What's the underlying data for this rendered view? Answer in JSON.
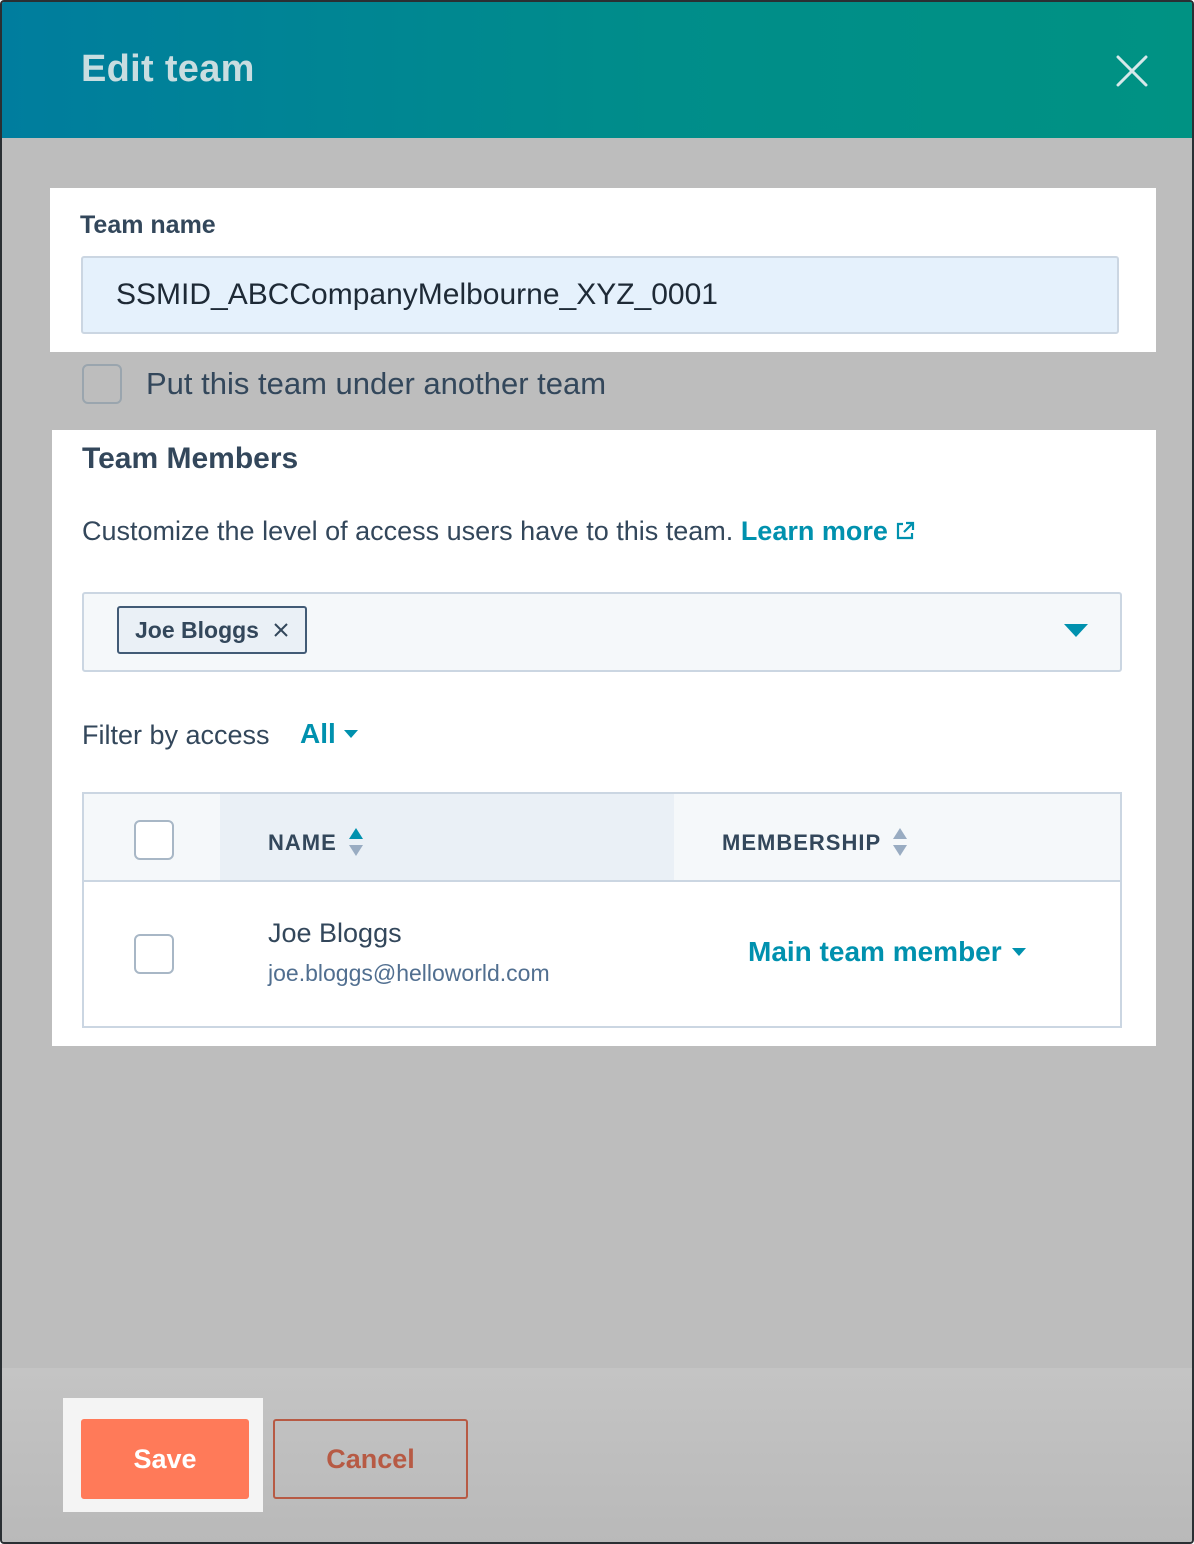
{
  "dialog": {
    "title": "Edit team"
  },
  "team_name": {
    "label": "Team name",
    "value": "SSMID_ABCCompanyMelbourne_XYZ_0001"
  },
  "subteam": {
    "label": "Put this team under another team",
    "checked": false
  },
  "members": {
    "title": "Team Members",
    "description": "Customize the level of access users have to this team.",
    "learn_more": "Learn more",
    "selected_tags": [
      "Joe Bloggs"
    ],
    "filter_label": "Filter by access",
    "filter_value": "All",
    "columns": {
      "name": "NAME",
      "membership": "MEMBERSHIP"
    },
    "rows": [
      {
        "name": "Joe Bloggs",
        "email": "joe.bloggs@helloworld.com",
        "membership": "Main team member"
      }
    ]
  },
  "footer": {
    "save_label": "Save",
    "cancel_label": "Cancel"
  },
  "colors": {
    "header_start": "#007d9e",
    "header_end": "#009283",
    "accent_link": "#0091ae",
    "primary_button": "#ff7a59",
    "secondary_button": "#b75a44",
    "text": "#33475b"
  },
  "icons": {
    "close": "close-icon",
    "external_link": "external-link-icon",
    "tag_remove": "tag-remove-icon",
    "dropdown": "caret-down-icon",
    "sort": "sort-icon"
  }
}
